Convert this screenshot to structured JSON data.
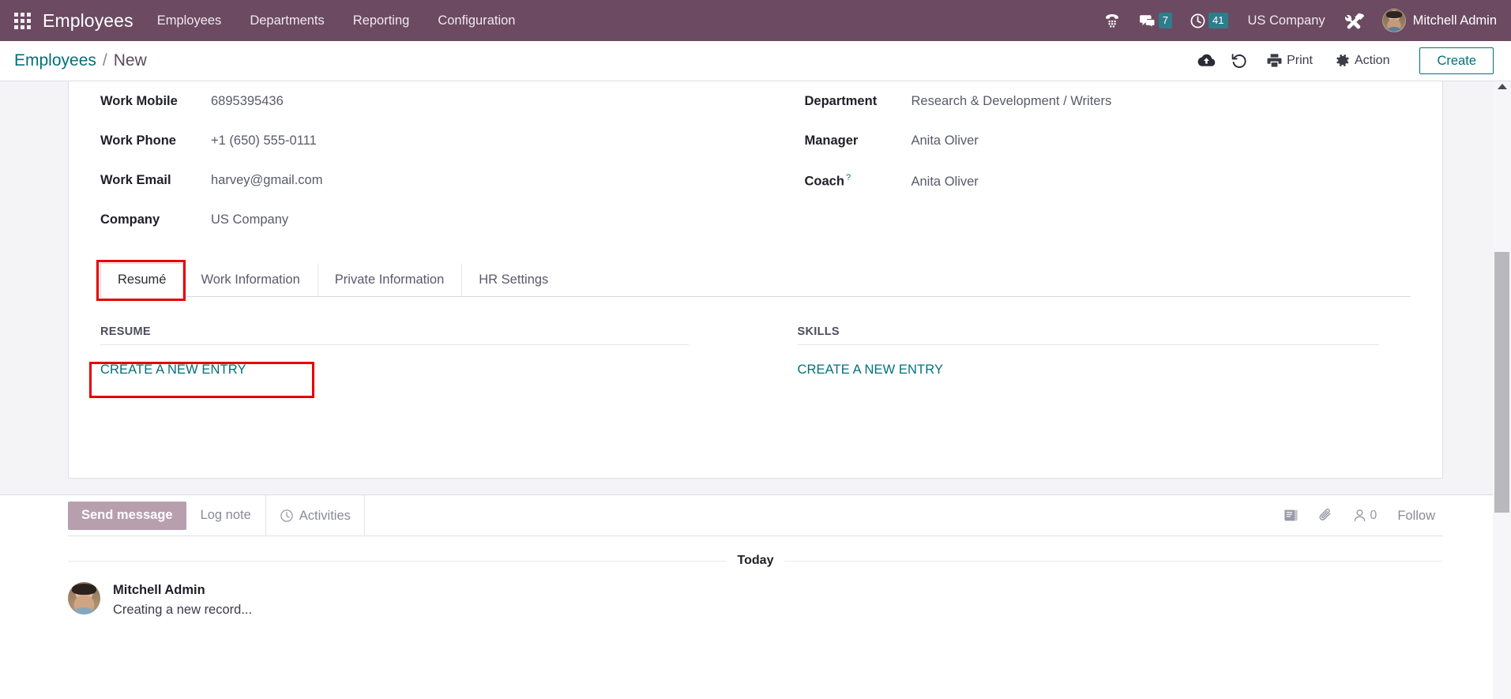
{
  "navbar": {
    "apps_icon": "apps-grid-icon",
    "brand": "Employees",
    "menu": [
      {
        "label": "Employees"
      },
      {
        "label": "Departments"
      },
      {
        "label": "Reporting"
      },
      {
        "label": "Configuration"
      }
    ],
    "icons": {
      "voip_phone": "phone-keypad-icon",
      "messages": "messages-icon",
      "activities": "clock-icon",
      "debug": "tools-icon"
    },
    "messages_count": "7",
    "activities_count": "41",
    "company": "US Company",
    "user": "Mitchell Admin",
    "accent": "#6b4a62",
    "badge_color": "#2e7d8a"
  },
  "control_panel": {
    "breadcrumb_root": "Employees",
    "breadcrumb_sep": "/",
    "breadcrumb_current": "New",
    "upload_icon": "cloud-upload-icon",
    "discard_icon": "undo-icon",
    "print_label": "Print",
    "print_icon": "printer-icon",
    "action_label": "Action",
    "action_icon": "gear-icon",
    "create_label": "Create",
    "accent": "#00717a"
  },
  "form": {
    "left_fields": [
      {
        "label": "Work Mobile",
        "value": "6895395436"
      },
      {
        "label": "Work Phone",
        "value": "+1 (650) 555-0111"
      },
      {
        "label": "Work Email",
        "value": "harvey@gmail.com"
      },
      {
        "label": "Company",
        "value": "US Company"
      }
    ],
    "right_fields": [
      {
        "label": "Department",
        "value": "Research & Development / Writers",
        "help": ""
      },
      {
        "label": "Manager",
        "value": "Anita Oliver",
        "help": ""
      },
      {
        "label": "Coach",
        "value": "Anita Oliver",
        "help": "?"
      }
    ],
    "tabs": [
      {
        "label": "Resumé",
        "active": true
      },
      {
        "label": "Work Information",
        "active": false
      },
      {
        "label": "Private Information",
        "active": false
      },
      {
        "label": "HR Settings",
        "active": false
      }
    ],
    "resume_section": {
      "title": "RESUME",
      "create_link": "CREATE A NEW ENTRY"
    },
    "skills_section": {
      "title": "SKILLS",
      "create_link": "CREATE A NEW ENTRY"
    },
    "highlight_color": "#e60000"
  },
  "chatter": {
    "send_message": "Send message",
    "log_note": "Log note",
    "activities": "Activities",
    "activities_icon": "clock-icon",
    "attachment_icon": "paperclip-icon",
    "log_icon": "book-icon",
    "followers_icon": "user-icon",
    "followers_count": "0",
    "follow_label": "Follow",
    "day_separator": "Today",
    "messages": [
      {
        "author": "Mitchell Admin",
        "body": "Creating a new record...",
        "avatar": "avatar"
      }
    ]
  },
  "scrollbar": {
    "up_arrow_icon": "caret-up-icon"
  }
}
